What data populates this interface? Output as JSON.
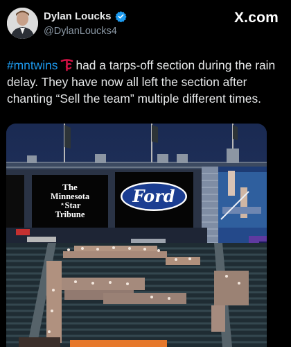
{
  "author": {
    "display_name": "Dylan Loucks",
    "handle": "@DylanLoucks4",
    "verified_icon": "verified-badge-icon",
    "avatar_icon": "profile-avatar-icon"
  },
  "brand": {
    "label": "X.com",
    "icon": "x-logo-icon"
  },
  "post": {
    "hashtag": "#mntwins",
    "team_icon": "twins-tc-logo-icon",
    "text": "had a tarps-off section during the rain delay. They have now all left the section after chanting “Sell the team” multiple different times."
  },
  "media": {
    "description_icon": "stadium-photo",
    "scoreboard_left": {
      "line1": "The",
      "line2": "Minnesota",
      "line3": "Star",
      "line4": "Tribune"
    },
    "scoreboard_center": {
      "label": "Ford"
    }
  },
  "colors": {
    "background": "#000000",
    "text": "#e7e9ea",
    "secondary": "#8b98a5",
    "link": "#1d9bf0",
    "twins_red": "#d31145",
    "ford_blue": "#1b3d91"
  }
}
